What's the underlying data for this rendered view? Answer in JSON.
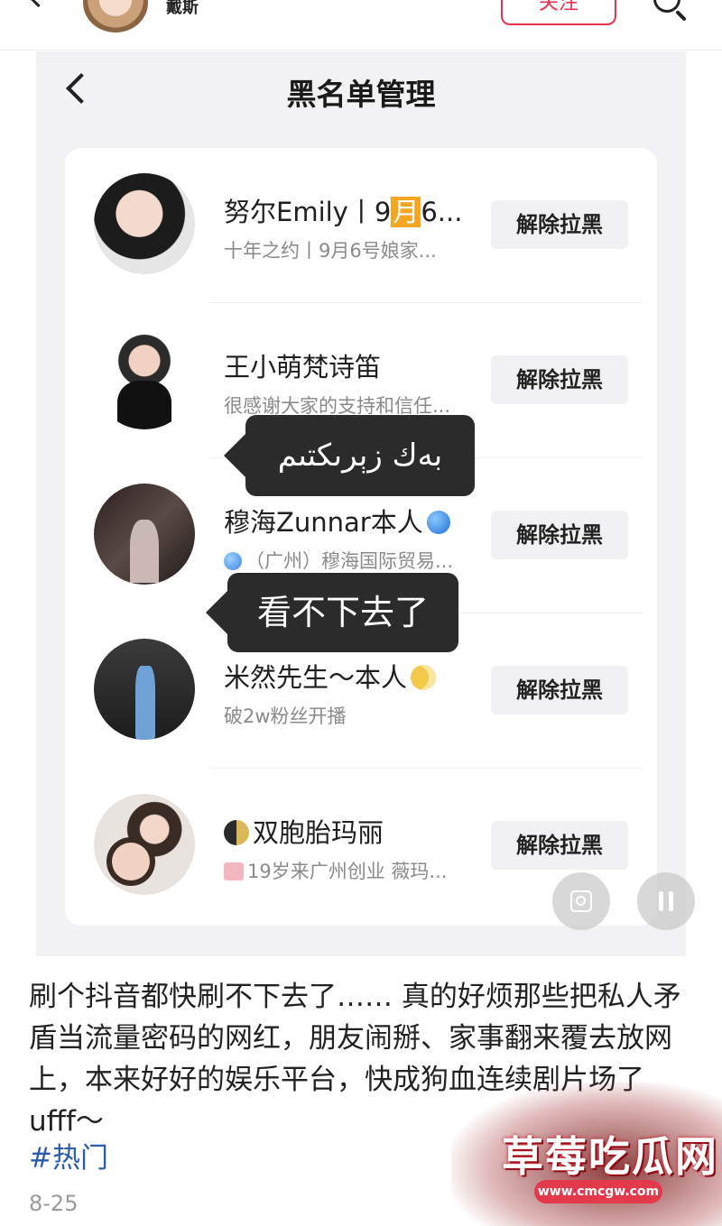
{
  "topbar": {
    "account_name": "戴斯",
    "follow_label": "关注"
  },
  "panel": {
    "title": "黑名单管理"
  },
  "blocked_list": [
    {
      "name_pre": "努尔Emily丨9",
      "name_hl": "月",
      "name_post": "6...",
      "subtitle": "十年之约丨9月6号娘家...",
      "action": "解除拉黑"
    },
    {
      "name": "王小萌梵诗笛",
      "subtitle": "很感谢大家的支持和信任...",
      "action": "解除拉黑"
    },
    {
      "name": "穆海Zunnar本人",
      "subtitle": "（广州）穆海国际贸易...",
      "action": "解除拉黑"
    },
    {
      "name": "米然先生～本人",
      "subtitle": "破2w粉丝开播",
      "action": "解除拉黑"
    },
    {
      "name": "双胞胎玛丽",
      "subtitle": "19岁来广州创业  薇玛...",
      "action": "解除拉黑"
    }
  ],
  "bubbles": {
    "first": "بەك زېرىكتىم",
    "second": "看不下去了"
  },
  "post": {
    "caption": "刷个抖音都快刷不下去了…… 真的好烦那些把私人矛盾当流量密码的网红，朋友闹掰、家事翻来覆去放网上，本来好好的娱乐平台，快成狗血连续剧片场了 ufff～",
    "hashtag": "#热门",
    "date": "8-25"
  },
  "watermark": {
    "title": "草莓吃瓜网",
    "url": "www.cmcgw.com"
  },
  "colors": {
    "follow_red": "#e8334f",
    "hashtag_blue": "#2a5caa",
    "bubble_dark": "#2b2b2b"
  }
}
